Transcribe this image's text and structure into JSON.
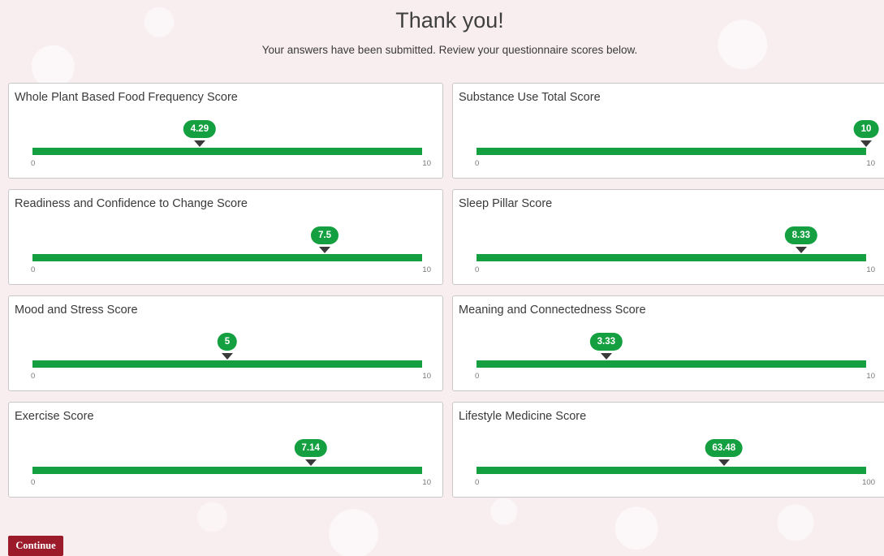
{
  "header": {
    "title": "Thank you!",
    "subtitle": "Your answers have been submitted. Review your questionnaire scores below."
  },
  "scores": [
    {
      "title": "Whole Plant Based Food Frequency Score",
      "value": 4.29,
      "value_label": "4.29",
      "min": 0,
      "max": 10,
      "min_label": "0",
      "max_label": "10"
    },
    {
      "title": "Substance Use Total Score",
      "value": 10,
      "value_label": "10",
      "min": 0,
      "max": 10,
      "min_label": "0",
      "max_label": "10"
    },
    {
      "title": "Readiness and Confidence to Change Score",
      "value": 7.5,
      "value_label": "7.5",
      "min": 0,
      "max": 10,
      "min_label": "0",
      "max_label": "10"
    },
    {
      "title": "Sleep Pillar Score",
      "value": 8.33,
      "value_label": "8.33",
      "min": 0,
      "max": 10,
      "min_label": "0",
      "max_label": "10"
    },
    {
      "title": "Mood and Stress Score",
      "value": 5,
      "value_label": "5",
      "min": 0,
      "max": 10,
      "min_label": "0",
      "max_label": "10"
    },
    {
      "title": "Meaning and Connectedness Score",
      "value": 3.33,
      "value_label": "3.33",
      "min": 0,
      "max": 10,
      "min_label": "0",
      "max_label": "10"
    },
    {
      "title": "Exercise Score",
      "value": 7.14,
      "value_label": "7.14",
      "min": 0,
      "max": 10,
      "min_label": "0",
      "max_label": "10"
    },
    {
      "title": "Lifestyle Medicine Score",
      "value": 63.48,
      "value_label": "63.48",
      "min": 0,
      "max": 100,
      "min_label": "0",
      "max_label": "100"
    }
  ],
  "footer": {
    "continue_label": "Continue"
  },
  "colors": {
    "accent_green": "#14a040",
    "button_maroon": "#9c1b2b",
    "marker_dark": "#3a3a3a"
  }
}
